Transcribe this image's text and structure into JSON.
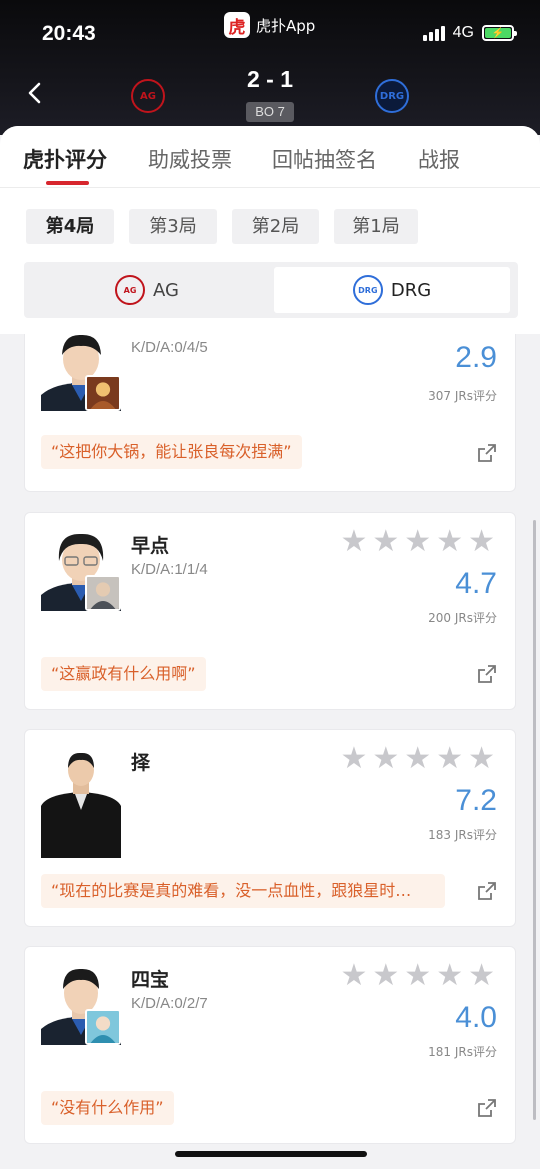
{
  "status_bar": {
    "time": "20:43",
    "app_name": "虎扑App",
    "app_logo_char": "虎",
    "network": "4G"
  },
  "match": {
    "score": "2 - 1",
    "format": "BO 7",
    "team_left": {
      "name": "AG",
      "color": "#c0141c"
    },
    "team_right": {
      "name": "DRG",
      "color": "#2f6ed9"
    }
  },
  "tabs": [
    {
      "label": "虎扑评分",
      "active": true
    },
    {
      "label": "助威投票",
      "active": false
    },
    {
      "label": "回帖抽签名",
      "active": false
    },
    {
      "label": "战报",
      "active": false
    }
  ],
  "games": [
    {
      "label": "第4局",
      "active": true
    },
    {
      "label": "第3局",
      "active": false
    },
    {
      "label": "第2局",
      "active": false
    },
    {
      "label": "第1局",
      "active": false
    }
  ],
  "team_switch": [
    {
      "label": "AG",
      "active": false
    },
    {
      "label": "DRG",
      "active": true
    }
  ],
  "players": [
    {
      "name": "",
      "kda": "K/D/A:0/4/5",
      "score": "2.9",
      "votes": "307 JRs评分",
      "comment": "“这把你大锅，能让张良每次捏满”"
    },
    {
      "name": "早点",
      "kda": "K/D/A:1/1/4",
      "score": "4.7",
      "votes": "200 JRs评分",
      "comment": "“这赢政有什么用啊”"
    },
    {
      "name": "择",
      "kda": "",
      "score": "7.2",
      "votes": "183 JRs评分",
      "comment": "“现在的比赛是真的难看，没一点血性，跟狼星时…"
    },
    {
      "name": "四宝",
      "kda": "K/D/A:0/2/7",
      "score": "4.0",
      "votes": "181 JRs评分",
      "comment": "“没有什么作用”"
    }
  ],
  "colors": {
    "accent": "#d7262d",
    "score_blue": "#4a8fd6",
    "comment_text": "#d9602a",
    "comment_bg": "#fdf2ea"
  },
  "icons": {
    "star": "★"
  }
}
